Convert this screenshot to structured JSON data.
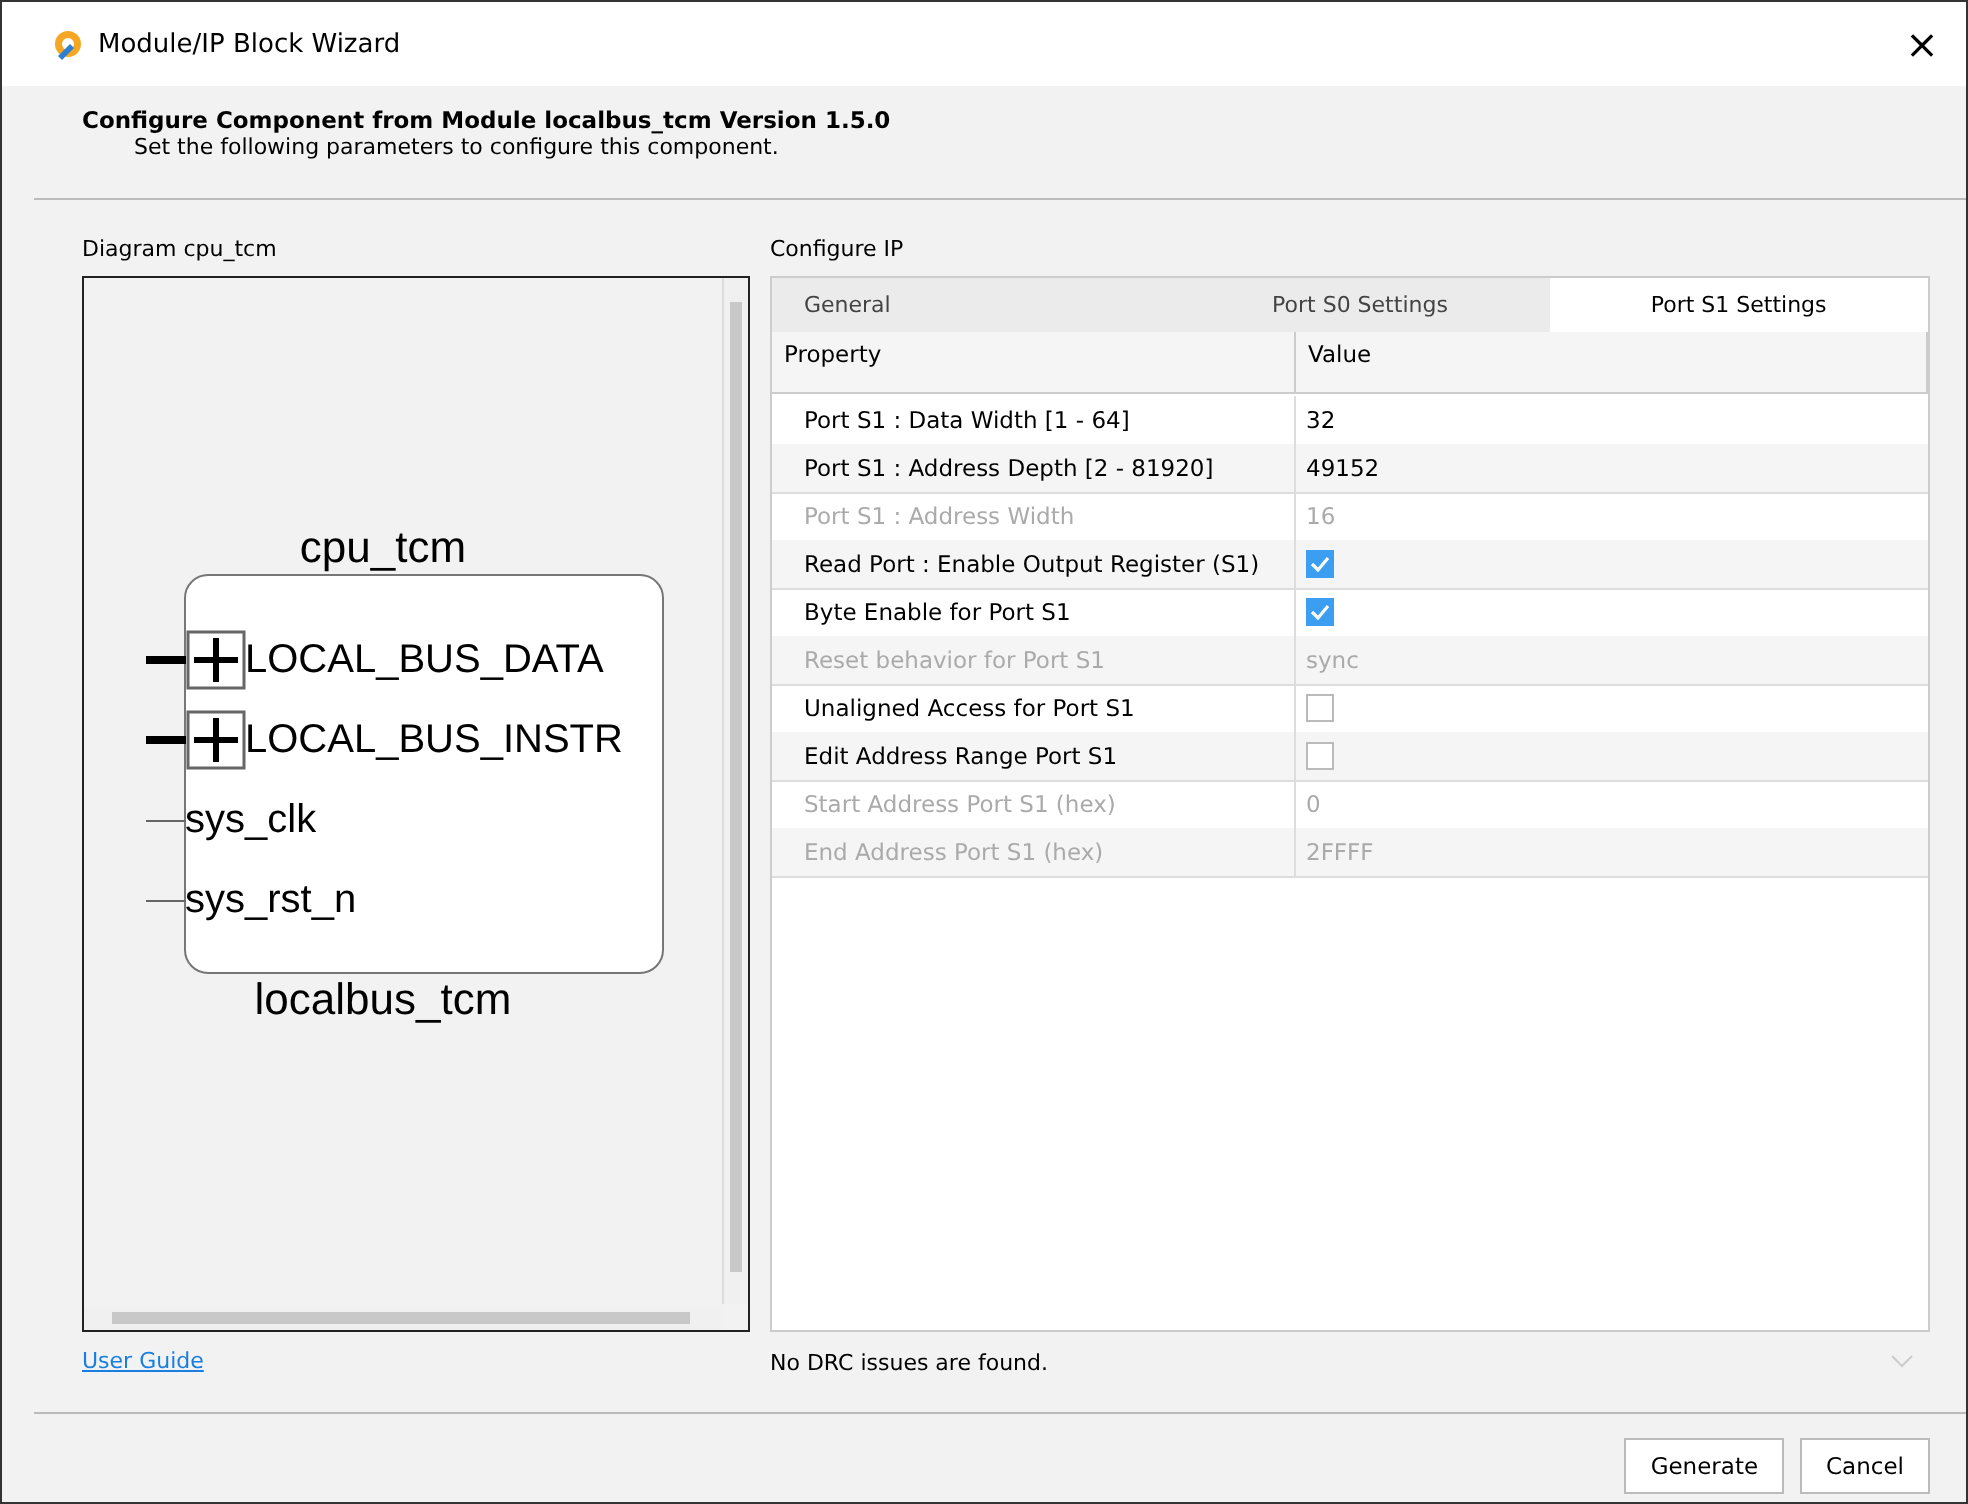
{
  "window": {
    "title": "Module/IP Block Wizard",
    "close": "×"
  },
  "header": {
    "title": "Configure Component from Module localbus_tcm Version 1.5.0",
    "subtitle": "Set the following parameters to configure this component."
  },
  "diagram": {
    "label": "Diagram cpu_tcm",
    "instance": "cpu_tcm",
    "module": "localbus_tcm",
    "ports": [
      {
        "kind": "bus",
        "name": "LOCAL_BUS_DATA"
      },
      {
        "kind": "bus",
        "name": "LOCAL_BUS_INSTR"
      },
      {
        "kind": "wire",
        "name": "sys_clk"
      },
      {
        "kind": "wire",
        "name": "sys_rst_n"
      }
    ]
  },
  "configure": {
    "label": "Configure IP",
    "tabs": [
      {
        "label": "General",
        "selected": false
      },
      {
        "label": "Port S0 Settings",
        "selected": false
      },
      {
        "label": "Port S1 Settings",
        "selected": true
      }
    ],
    "columns": [
      "Property",
      "Value"
    ],
    "rows": [
      {
        "kind": "text",
        "property": "Port S1 : Data Width  [1 - 64]",
        "value": "32",
        "disabled": false
      },
      {
        "kind": "text",
        "property": "Port S1 : Address Depth  [2 - 81920]",
        "value": "49152",
        "disabled": false
      },
      {
        "kind": "text",
        "property": "Port S1 : Address Width",
        "value": "16",
        "disabled": true
      },
      {
        "kind": "checkbox",
        "property": "Read Port  : Enable Output Register (S1)",
        "checked": true,
        "disabled": false
      },
      {
        "kind": "checkbox",
        "property": "Byte Enable for Port S1",
        "checked": true,
        "disabled": false
      },
      {
        "kind": "text",
        "property": "Reset behavior for Port S1",
        "value": "sync",
        "disabled": true
      },
      {
        "kind": "checkbox",
        "property": "Unaligned Access for Port S1",
        "checked": false,
        "disabled": false
      },
      {
        "kind": "checkbox",
        "property": "Edit Address Range Port S1",
        "checked": false,
        "disabled": false
      },
      {
        "kind": "text",
        "property": "Start Address Port S1 (hex)",
        "value": "0",
        "disabled": true
      },
      {
        "kind": "text",
        "property": "End Address Port S1 (hex)",
        "value": "2FFFF",
        "disabled": true
      }
    ]
  },
  "user_guide_link": "User Guide",
  "status": "No DRC issues are found.",
  "buttons": [
    "Generate",
    "Cancel"
  ]
}
